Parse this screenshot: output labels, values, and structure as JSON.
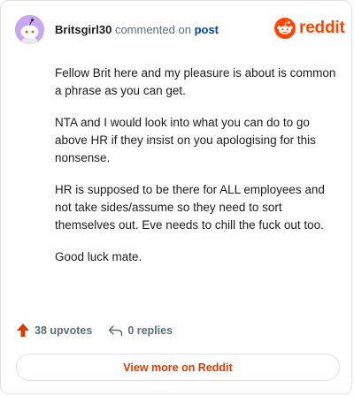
{
  "header": {
    "username": "Britsgirl30",
    "commented_text": "commented on",
    "post_link": "post",
    "brand": "reddit"
  },
  "comment": {
    "paragraphs": [
      "Fellow Brit here and my pleasure is about is common a phrase as you can get.",
      "NTA and I would look into what you can do to go above HR if they insist on you apologising for this nonsense.",
      "HR is supposed to be there for ALL employees and not take sides/assume so they need to sort themselves out. Eve needs to chill the fuck out too.",
      "Good luck mate."
    ]
  },
  "actions": {
    "upvotes": "38 upvotes",
    "replies": "0 replies"
  },
  "footer": {
    "view_more": "View more on Reddit"
  },
  "colors": {
    "brand": "#ff4500",
    "link": "#0045ac",
    "upvote": "#d93a00",
    "muted": "#576f76",
    "avatar_bg": "#c9a7f0"
  },
  "icons": {
    "avatar": "snoo-avatar",
    "brand": "reddit-snoo-logo",
    "upvote": "upvote-arrow-icon",
    "reply": "reply-arrow-icon"
  }
}
